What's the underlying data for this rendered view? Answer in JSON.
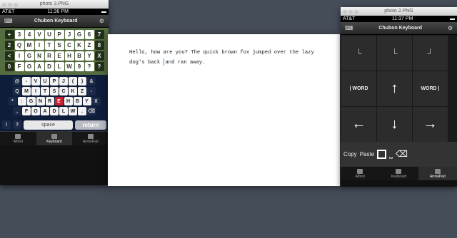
{
  "window_left": {
    "title": "photo 3.PNG",
    "status": {
      "carrier": "AT&T",
      "time": "11:36 PM"
    },
    "nav_title": "Chubon Keyboard",
    "kb1_rows": [
      [
        "+",
        "3",
        "4",
        "V",
        "U",
        "P",
        "J",
        "G",
        "6",
        "7"
      ],
      [
        "2",
        "Q",
        "M",
        "I",
        "T",
        "S",
        "C",
        "K",
        "Z",
        "8"
      ],
      [
        "<",
        "I",
        "G",
        "N",
        "R",
        "E",
        "H",
        "B",
        "Y",
        "X"
      ],
      [
        "0",
        "F",
        "O",
        "A",
        "D",
        "L",
        "W",
        "9",
        "?",
        "?"
      ]
    ],
    "kb2_rows": [
      [
        "@",
        "-",
        "V",
        "U",
        "P",
        "J",
        "(",
        ")",
        "&"
      ],
      [
        "Q",
        "M",
        "I",
        "T",
        "S",
        "C",
        "K",
        "Z",
        "-"
      ],
      [
        "*",
        ":",
        "G",
        "N",
        "R",
        "E",
        "H",
        "B",
        "Y",
        "X"
      ],
      [
        ",",
        "F",
        "O",
        "A",
        "D",
        "L",
        "W",
        ".",
        "⌫"
      ]
    ],
    "bottom": {
      "left": "!",
      "mid": "?",
      "space": "space",
      "return": "return"
    },
    "tabs": [
      "Alfred",
      "Keyboard",
      "ArrowPad"
    ]
  },
  "document": {
    "before": "Hello, how are you? The quick brown fox jumped over the lazy dog's back ",
    "after": "and ran away."
  },
  "window_right": {
    "title": "photo 2.PNG",
    "status": {
      "carrier": "AT&T",
      "time": "11:37 PM"
    },
    "nav_title": "Chubon Keyboard",
    "word_left": "| WORD",
    "word_right": "WORD |",
    "copy": "Copy",
    "paste": "Paste",
    "tabs": [
      "Alfred",
      "Keyboard",
      "ArrowPad"
    ]
  }
}
